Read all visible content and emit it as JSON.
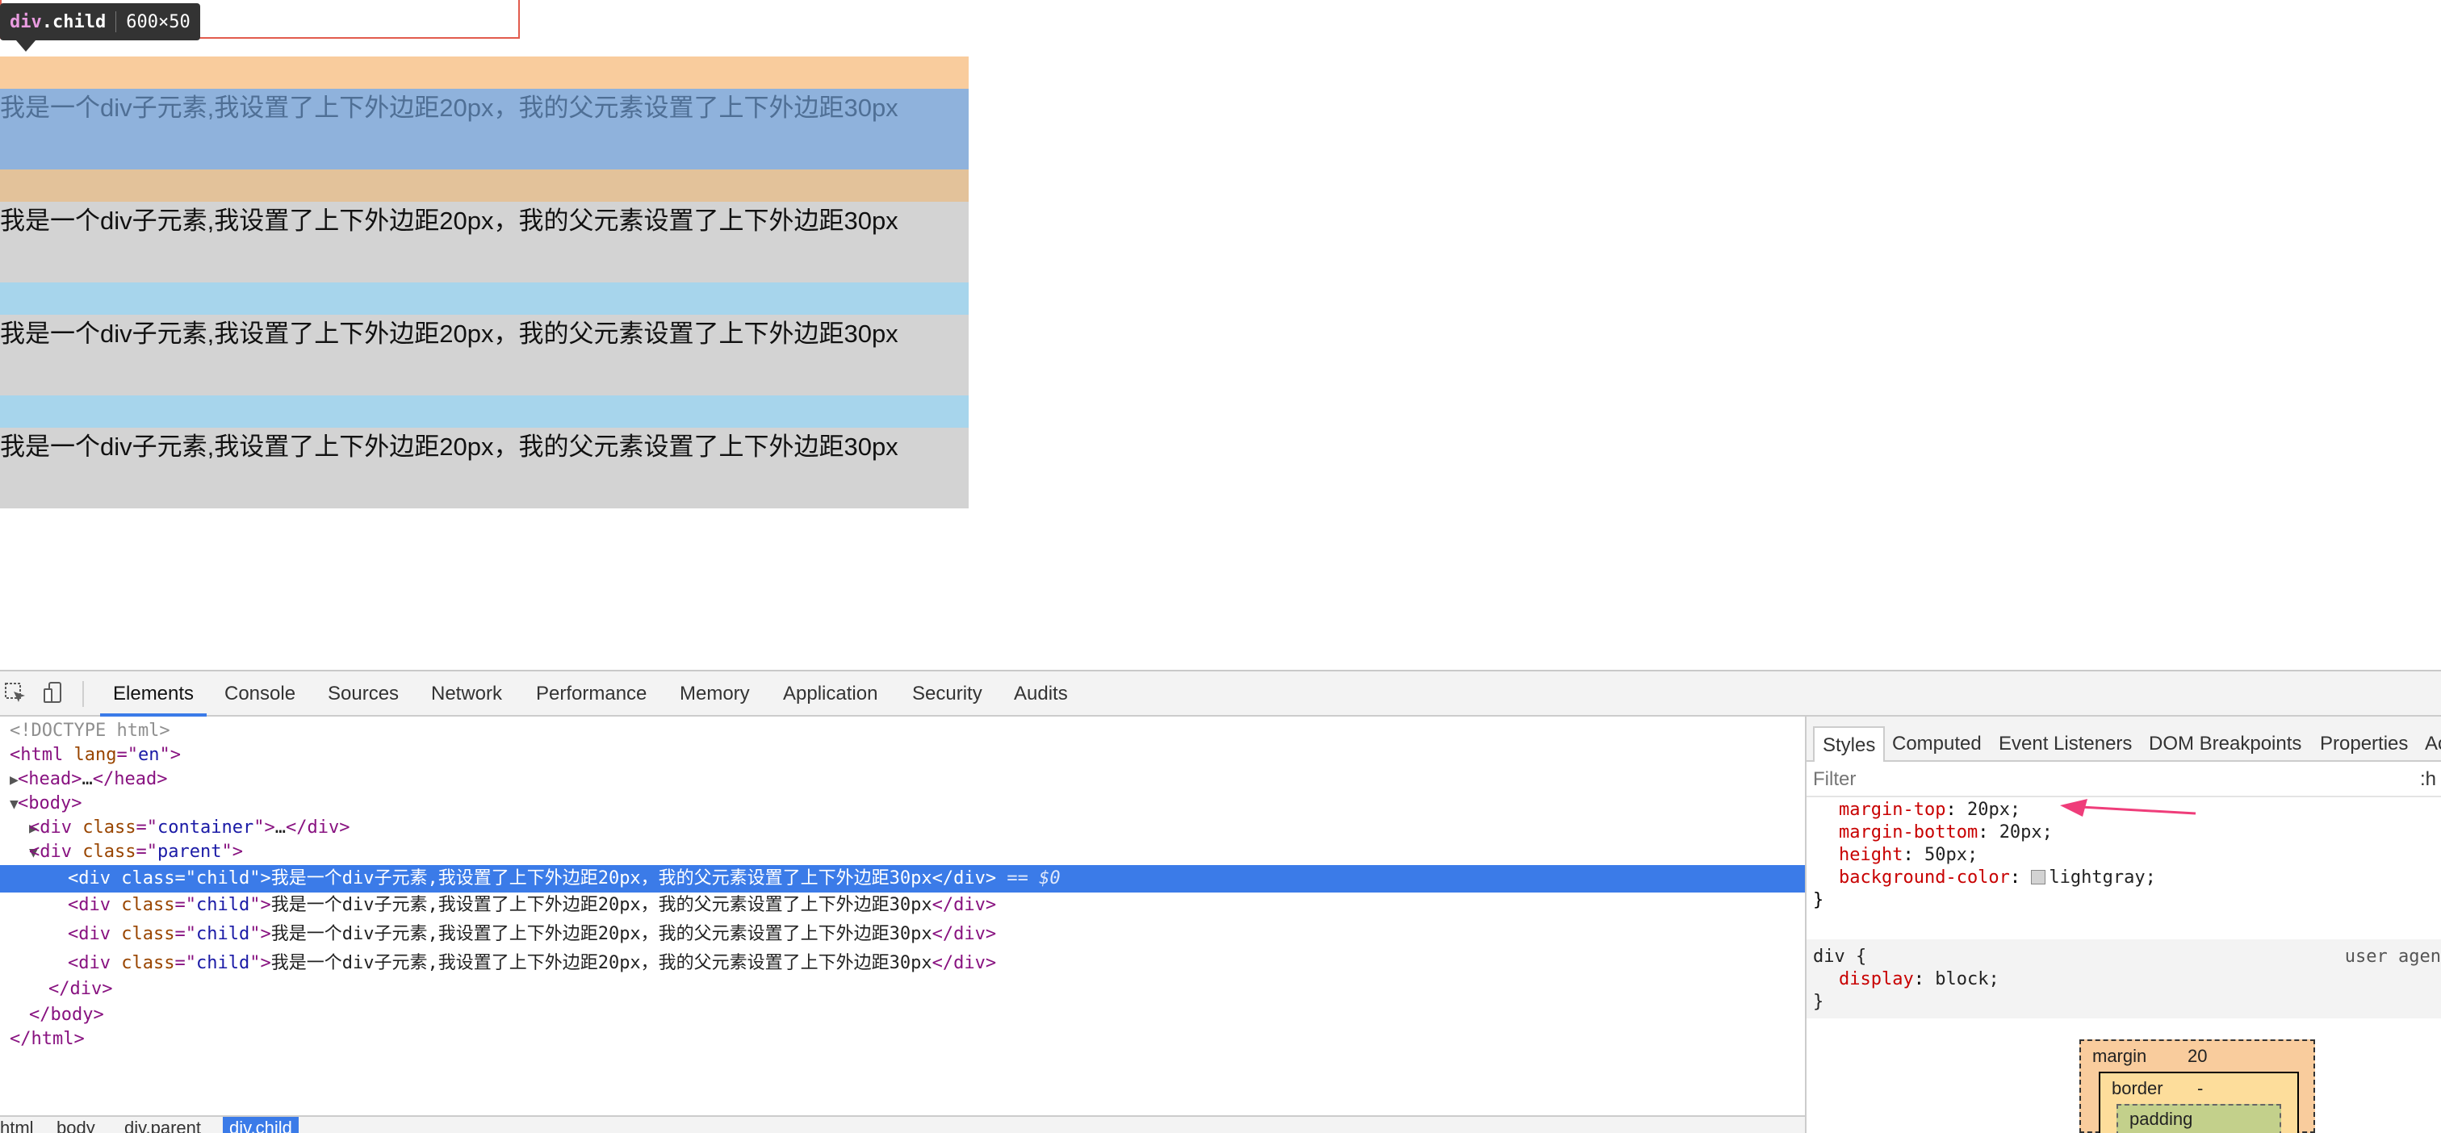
{
  "preview": {
    "tooltip": {
      "tag": "div",
      "class": ".child",
      "size": "600×50"
    },
    "child_text": "我是一个div子元素,我设置了上下外边距20px，我的父元素设置了上下外边距30px",
    "colors": {
      "margin_overlay": "#f9cc9d",
      "content_overlay": "#8fb2dc",
      "child_bg": "#d3d3d3",
      "gap_bg": "#a7d5ec",
      "highlight_border": "#e25b4d"
    }
  },
  "devtools": {
    "tabs": [
      "Elements",
      "Console",
      "Sources",
      "Network",
      "Performance",
      "Memory",
      "Application",
      "Security",
      "Audits"
    ],
    "active_tab": "Elements",
    "icons": {
      "inspect": "inspect-element-icon",
      "device": "device-toolbar-icon"
    },
    "dom": {
      "doctype": "<!DOCTYPE html>",
      "html_open_tag": "html",
      "lang_attr": "lang",
      "lang_val": "en",
      "head": "head",
      "head_ellipsis": "…",
      "body": "body",
      "div": "div",
      "class_attr": "class",
      "container": "container",
      "parent": "parent",
      "child": "child",
      "child_text": "我是一个div子元素,我设置了上下外边距20px，我的父元素设置了上下外边距30px",
      "selected_marker": "== $0",
      "ellipsis": "…"
    },
    "breadcrumb": [
      "html",
      "body",
      "div.parent",
      "div.child"
    ],
    "styles_tabs": [
      "Styles",
      "Computed",
      "Event Listeners",
      "DOM Breakpoints",
      "Properties",
      "Ac"
    ],
    "filter_placeholder": "Filter",
    "filter_hov": ":h",
    "rule1": [
      {
        "prop": "margin-top",
        "value": "20px;"
      },
      {
        "prop": "margin-bottom",
        "value": "20px;"
      },
      {
        "prop": "height",
        "value": "50px;"
      },
      {
        "prop": "background-color",
        "value": "lightgray;"
      }
    ],
    "rule1_close": "}",
    "rule2_selector": "div {",
    "rule2_origin": "user agen",
    "rule2_prop": "display",
    "rule2_value": "block;",
    "rule2_close": "}",
    "box_model": {
      "margin_label": "margin",
      "margin_value": "20",
      "border_label": "border",
      "border_value": "-",
      "padding_label": "padding"
    }
  }
}
